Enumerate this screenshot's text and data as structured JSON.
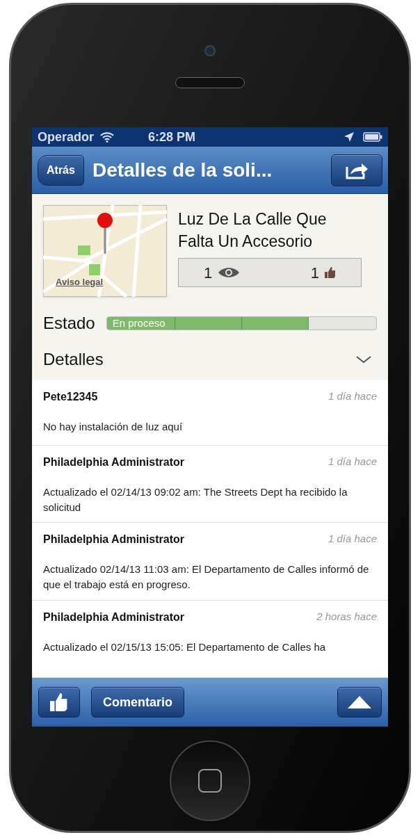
{
  "status_bar": {
    "carrier": "Operador",
    "time": "6:28 PM"
  },
  "nav_bar": {
    "back": "Atrás",
    "title": "Detalles de la soli..."
  },
  "request": {
    "map_link": "Aviso legal",
    "title": "Luz De La Calle Que Falta Un Accesorio",
    "views": "1",
    "likes": "1"
  },
  "status": {
    "label": "Estado",
    "value": "En proceso",
    "level": 0.75
  },
  "details": {
    "label": "Detalles",
    "expanded": false
  },
  "comments": [
    {
      "author": "Pete12345",
      "time": "1 día hace",
      "text": "No hay instalación de luz aquí"
    },
    {
      "author": "Philadelphia Administrator",
      "time": "1 día hace",
      "text": "Actualizado el 02/14/13 09:02 am: The Streets Dept ha recibido la solicitud"
    },
    {
      "author": "Philadelphia Administrator",
      "time": "1 día hace",
      "text": "Actualizado 02/14/13 11:03 am: El Departamento de Calles informó de que el trabajo está en progreso."
    },
    {
      "author": "Philadelphia Administrator",
      "time": "2 horas hace",
      "text": "Actualizado el 02/15/13 15:05: El Departamento de Calles ha"
    }
  ],
  "toolbar": {
    "comment": "Comentario"
  }
}
